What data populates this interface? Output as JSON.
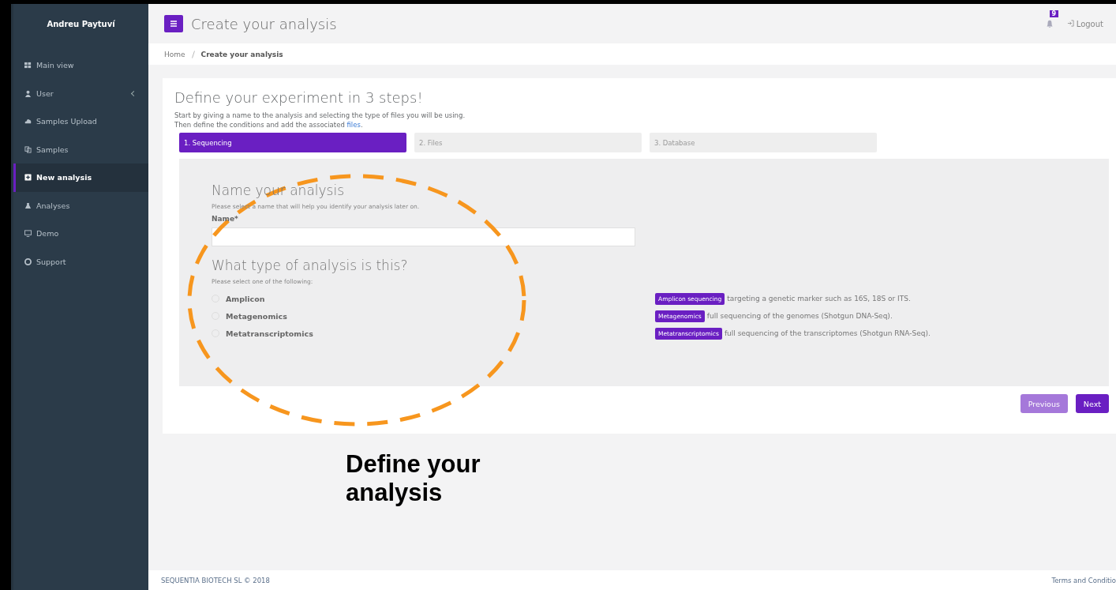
{
  "sidebar": {
    "user_name": "Andreu Paytuví",
    "items": [
      {
        "label": "Main view",
        "selected": false,
        "has_submenu": false
      },
      {
        "label": "User",
        "selected": false,
        "has_submenu": true
      },
      {
        "label": "Samples Upload",
        "selected": false,
        "has_submenu": false
      },
      {
        "label": "Samples",
        "selected": false,
        "has_submenu": false
      },
      {
        "label": "New analysis",
        "selected": true,
        "has_submenu": false
      },
      {
        "label": "Analyses",
        "selected": false,
        "has_submenu": false
      },
      {
        "label": "Demo",
        "selected": false,
        "has_submenu": false
      },
      {
        "label": "Support",
        "selected": false,
        "has_submenu": false
      }
    ]
  },
  "header": {
    "title": "Create your analysis",
    "notification_count": "9",
    "logout": "Logout"
  },
  "breadcrumb": [
    "Home",
    "Create your analysis"
  ],
  "card": {
    "heading": "Define your experiment in 3 steps!",
    "intro": "Start by giving a name to the analysis and selecting the type of files you will be using.",
    "intro_2": {
      "text": "Then define the conditions and add the associated ",
      "link": "files",
      "after": "."
    },
    "steps": [
      {
        "label": "1. Sequencing",
        "selected": true
      },
      {
        "label": "2. Files",
        "selected": false
      },
      {
        "label": "3. Database",
        "selected": false
      }
    ],
    "name_section": {
      "heading": "Name your analysis",
      "help": "Please select a name that will help you identify your analysis later on.",
      "label": "Name*"
    },
    "type_section": {
      "heading": "What type of analysis is this?",
      "help": "Please select one of the following:",
      "options": [
        {
          "label": "Amplicon",
          "selected": false,
          "tag": "Amplicon sequencing",
          "description": "targeting a genetic marker such as 16S, 18S or ITS."
        },
        {
          "label": "Metagenomics",
          "selected": false,
          "tag": "Metagenomics",
          "description": "full sequencing of the genomes (Shotgun DNA-Seq)."
        },
        {
          "label": "Metatranscriptomics",
          "selected": false,
          "tag": "Metatranscriptomics",
          "description": "full sequencing of the transcriptomes (Shotgun RNA-Seq)."
        }
      ]
    },
    "buttons": [
      {
        "label": "Previous",
        "disabled": true
      },
      {
        "label": "Next",
        "disabled": false
      }
    ]
  },
  "footer": {
    "copyright": "SEQUENTIA BIOTECH SL © 2018",
    "terms": "Terms and Conditio"
  },
  "annotation": {
    "caption": "Define your analysis"
  }
}
